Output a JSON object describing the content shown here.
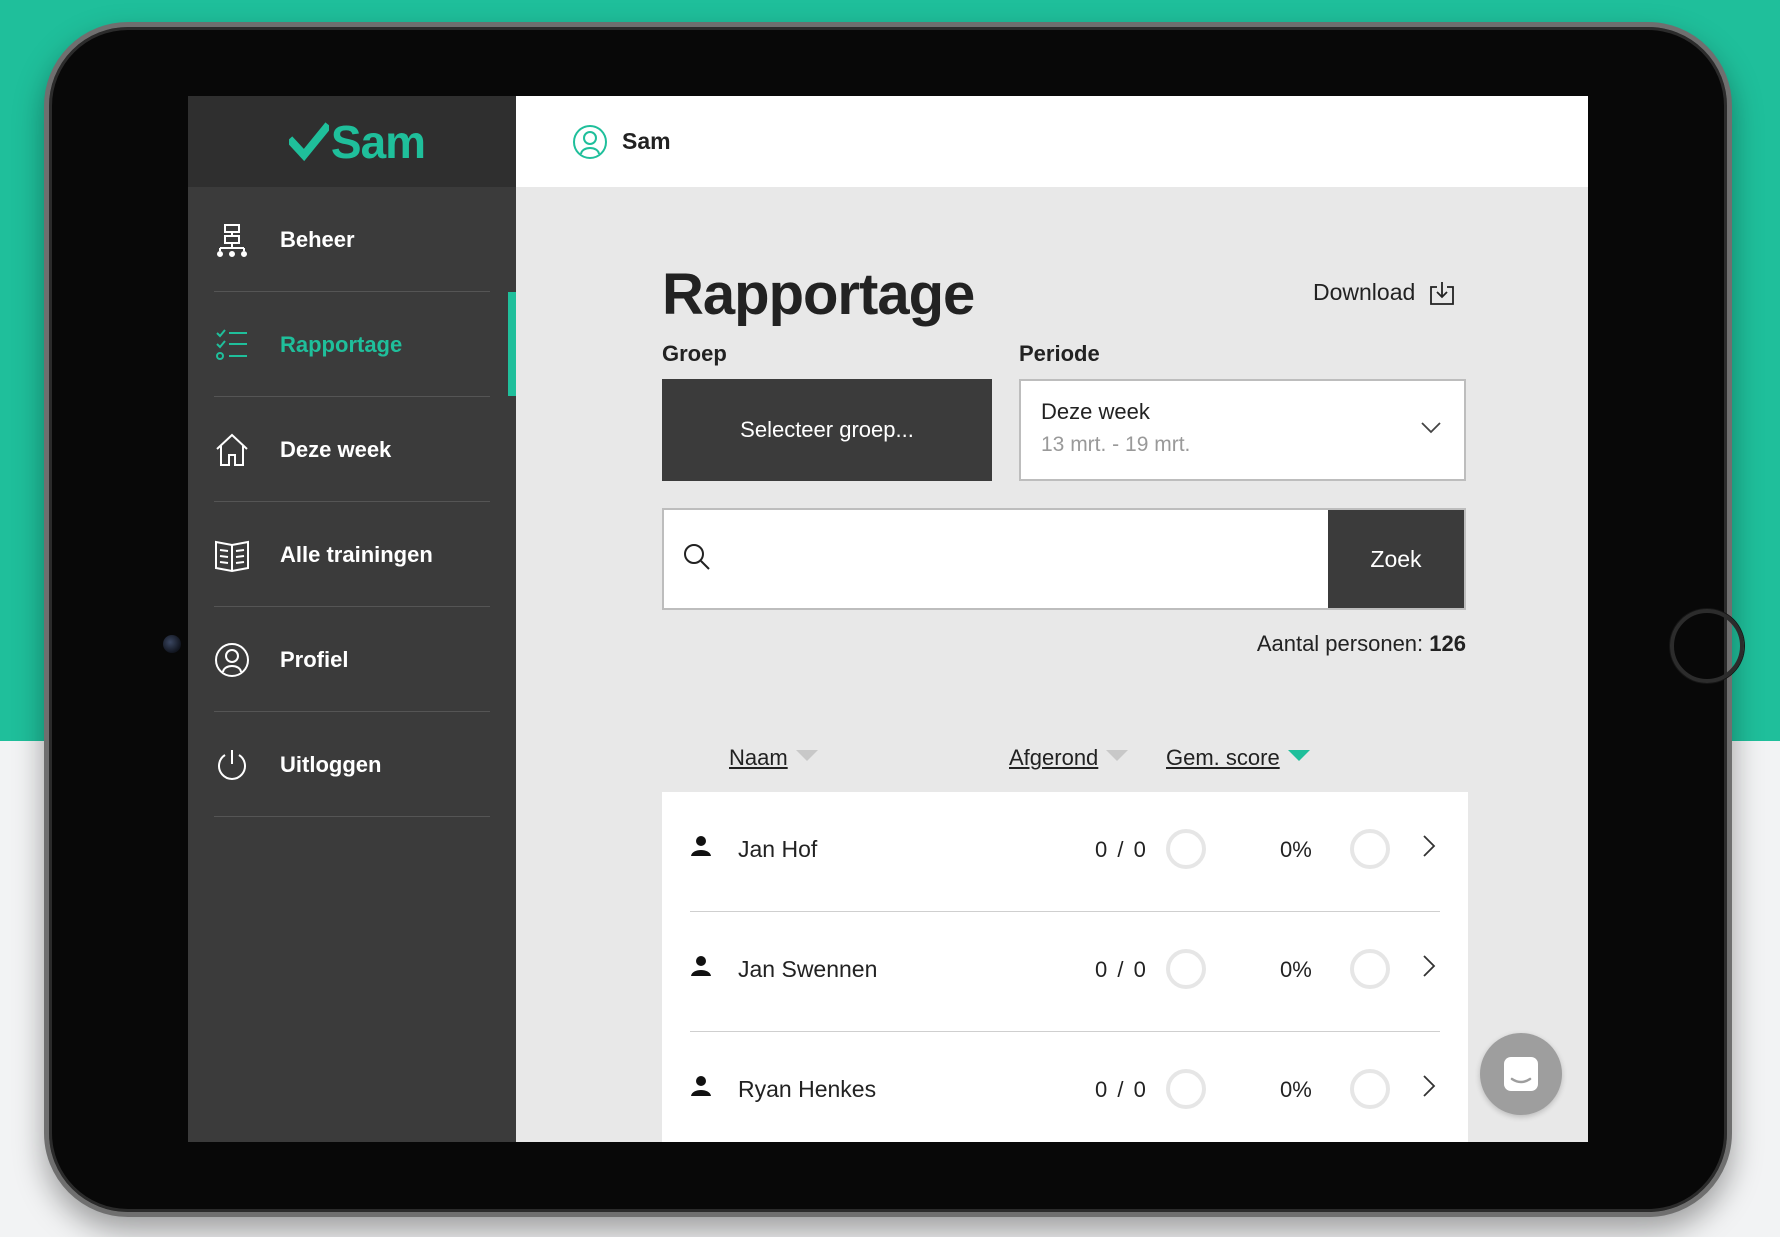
{
  "brand": {
    "name": "Sam",
    "accent_color": "#1fbf9b"
  },
  "sidebar": {
    "items": [
      {
        "label": "Beheer",
        "icon": "org-chart-icon",
        "active": false
      },
      {
        "label": "Rapportage",
        "icon": "checklist-icon",
        "active": true
      },
      {
        "label": "Deze week",
        "icon": "home-icon",
        "active": false
      },
      {
        "label": "Alle trainingen",
        "icon": "book-icon",
        "active": false
      },
      {
        "label": "Profiel",
        "icon": "user-circle-icon",
        "active": false
      },
      {
        "label": "Uitloggen",
        "icon": "power-icon",
        "active": false
      }
    ]
  },
  "topbar": {
    "user_name": "Sam"
  },
  "page": {
    "title": "Rapportage",
    "download_label": "Download",
    "groep_label": "Groep",
    "groep_select": "Selecteer groep...",
    "periode_label": "Periode",
    "periode_value": "Deze week",
    "periode_dates": "13 mrt. - 19 mrt.",
    "search_placeholder": "",
    "search_button": "Zoek",
    "count_label": "Aantal personen:",
    "count_value": "126"
  },
  "table": {
    "columns": [
      {
        "label": "Naam",
        "sorted": false
      },
      {
        "label": "Afgerond",
        "sorted": false
      },
      {
        "label": "Gem. score",
        "sorted": true
      }
    ],
    "rows": [
      {
        "name": "Jan Hof",
        "afgerond": "0 / 0",
        "score": "0%"
      },
      {
        "name": "Jan Swennen",
        "afgerond": "0 / 0",
        "score": "0%"
      },
      {
        "name": "Ryan Henkes",
        "afgerond": "0 / 0",
        "score": "0%"
      }
    ]
  },
  "chat": {
    "icon": "chat-icon"
  }
}
